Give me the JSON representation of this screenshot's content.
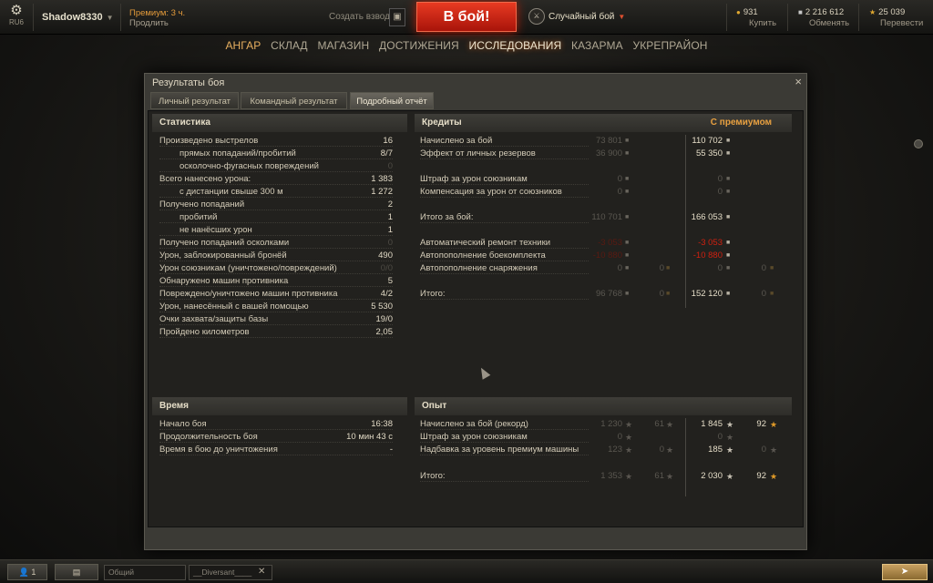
{
  "topbar": {
    "settings_gear": "⚙",
    "server": "RU6",
    "player": "Shadow8330",
    "premium_line1": "Премиум: 3 ч.",
    "premium_line2": "Продлить",
    "platoon_label": "Создать взвод",
    "battle_button": "В бой!",
    "mode_label": "Случайный бой",
    "gold_amount": "931",
    "gold_action": "Купить",
    "credits_amount": "2 216 612",
    "credits_action": "Обменять",
    "free_xp_amount": "25 039",
    "free_xp_action": "Перевести",
    "colors": {
      "battle": "#d02010",
      "premium": "#e39a3a",
      "gold": "#e0a830"
    }
  },
  "nav": [
    "АНГАР",
    "СКЛАД",
    "МАГАЗИН",
    "ДОСТИЖЕНИЯ",
    "ИССЛЕДОВАНИЯ",
    "КАЗАРМА",
    "УКРЕПРАЙОН"
  ],
  "window": {
    "title": "Результаты боя",
    "close": "×",
    "tabs": [
      "Личный результат",
      "Командный результат",
      "Подробный отчёт"
    ],
    "selected_tab": "Подробный отчёт"
  },
  "stats": {
    "header": "Статистика",
    "rows": [
      {
        "label": "Произведено выстрелов",
        "value": "16"
      },
      {
        "label": "прямых попаданий/пробитий",
        "value": "8/7"
      },
      {
        "label": "осколочно-фугасных повреждений",
        "value": "0"
      },
      {
        "label": "Всего нанесено урона:",
        "value": "1 383"
      },
      {
        "label": "с дистанции свыше 300 м",
        "value": "1 272"
      },
      {
        "label": "Получено попаданий",
        "value": "2"
      },
      {
        "label": "пробитий",
        "value": "1"
      },
      {
        "label": "не нанёсших урон",
        "value": "1"
      },
      {
        "label": "Получено попаданий осколками",
        "value": "0"
      },
      {
        "label": "Урон, заблокированный бронёй",
        "value": "490"
      },
      {
        "label": "Урон союзникам (уничтожено/повреждений)",
        "value": "0/0"
      },
      {
        "label": "Обнаружено машин противника",
        "value": "5"
      },
      {
        "label": "Повреждено/уничтожено машин противника",
        "value": "4/2"
      },
      {
        "label": "Урон, нанесённый с вашей помощью",
        "value": "5 530"
      },
      {
        "label": "Очки захвата/защиты базы",
        "value": "19/0"
      },
      {
        "label": "Пройдено километров",
        "value": "2,05"
      }
    ]
  },
  "credits": {
    "header": "Кредиты",
    "premium_header": "С премиумом",
    "rows": [
      {
        "label": "Начислено за бой",
        "base": "73 801",
        "base_gold": "",
        "prem": "110 702",
        "prem_gold": ""
      },
      {
        "label": "Эффект от личных резервов",
        "base": "36 900",
        "base_gold": "",
        "prem": "55 350",
        "prem_gold": ""
      },
      {
        "label": "Штраф за урон союзникам",
        "base": "0",
        "base_gold": "",
        "prem": "0",
        "prem_gold": ""
      },
      {
        "label": "Компенсация за урон от союзников",
        "base": "0",
        "base_gold": "",
        "prem": "0",
        "prem_gold": ""
      },
      {
        "label": "Итого за бой:",
        "base": "110 701",
        "base_gold": "",
        "prem": "166 053",
        "prem_gold": ""
      },
      {
        "label": "Автоматический ремонт техники",
        "base": "-3 053",
        "base_gold": "",
        "prem": "-3 053",
        "prem_gold": ""
      },
      {
        "label": "Автопополнение боекомплекта",
        "base": "-10 880",
        "base_gold": "",
        "prem": "-10 880",
        "prem_gold": ""
      },
      {
        "label": "Автопополнение снаряжения",
        "base": "0",
        "base_gold": "0",
        "prem": "0",
        "prem_gold": "0"
      },
      {
        "label": "Итого:",
        "base": "96 768",
        "base_gold": "0",
        "prem": "152 120",
        "prem_gold": "0"
      }
    ]
  },
  "time": {
    "header": "Время",
    "rows": [
      {
        "label": "Начало боя",
        "value": "16:38"
      },
      {
        "label": "Продолжительность боя",
        "value": "10 мин 43 с"
      },
      {
        "label": "Время в бою до уничтожения",
        "value": "-"
      }
    ]
  },
  "xp": {
    "header": "Опыт",
    "rows": [
      {
        "label": "Начислено за бой (рекорд)",
        "base": "1 230",
        "base_free": "61",
        "prem": "1 845",
        "prem_free": "92"
      },
      {
        "label": "Штраф за урон союзникам",
        "base": "0",
        "base_free": "",
        "prem": "0",
        "prem_free": ""
      },
      {
        "label": "Надбавка за уровень премиум машины",
        "base": "123",
        "base_free": "0",
        "prem": "185",
        "prem_free": "0"
      },
      {
        "label": "Итого:",
        "base": "1 353",
        "base_free": "61",
        "prem": "2 030",
        "prem_free": "92"
      }
    ]
  },
  "bottombar": {
    "players_count": "1",
    "chat_channel": "Общий",
    "chat_input": "__Diversant____",
    "close": "✕"
  }
}
